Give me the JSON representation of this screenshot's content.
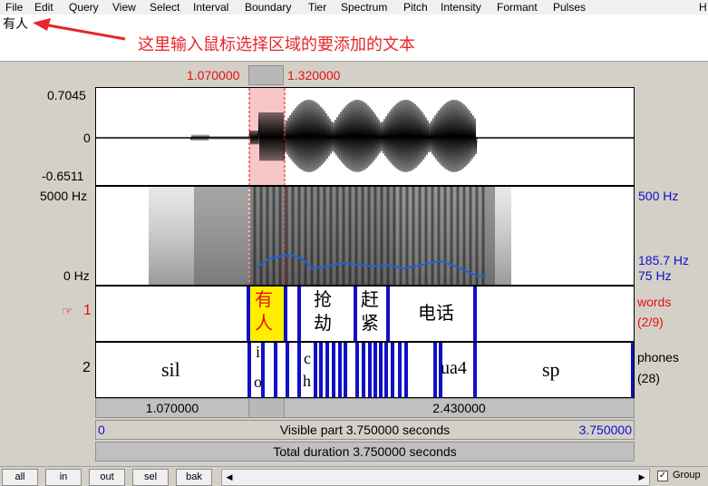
{
  "menu": [
    "File",
    "Edit",
    "Query",
    "View",
    "Select",
    "Interval",
    "Boundary",
    "Tier",
    "Spectrum",
    "Pitch",
    "Intensity",
    "Formant",
    "Pulses",
    "H"
  ],
  "text_entry": {
    "value": "有人"
  },
  "annotation": "这里输入鼠标选择区域的要添加的文本",
  "selection": {
    "start": "1.070000",
    "end": "1.320000"
  },
  "waveform": {
    "ymax": "0.7045",
    "zero": "0",
    "ymin": "-0.6511"
  },
  "spectrogram": {
    "top_left": "5000 Hz",
    "bottom_left": "0 Hz",
    "top_right": "500 Hz",
    "pitch_value": "185.7 Hz",
    "bottom_right": "75 Hz"
  },
  "tier1": {
    "marker": "☞",
    "number": "1",
    "name": "words",
    "count": "(2/9)",
    "selected_label": "有\n人",
    "labels": [
      {
        "id": "qiang",
        "text": "抢\n劫"
      },
      {
        "id": "gan",
        "text": "赶\n紧"
      },
      {
        "id": "dianhua",
        "text": "电话"
      }
    ]
  },
  "tier2": {
    "number": "2",
    "name": "phones",
    "count": "(28)",
    "labels": [
      {
        "id": "sil",
        "text": "sil"
      },
      {
        "id": "i",
        "text": "i"
      },
      {
        "id": "o",
        "text": "o"
      },
      {
        "id": "c",
        "text": "c"
      },
      {
        "id": "h",
        "text": "h"
      },
      {
        "id": "ua4",
        "text": "ua4"
      },
      {
        "id": "sp",
        "text": "sp"
      }
    ]
  },
  "strips": {
    "seg_left": "1.070000",
    "seg_right": "2.430000",
    "visible_start": "0",
    "visible_text": "Visible part 3.750000 seconds",
    "visible_end": "3.750000",
    "total_text": "Total duration 3.750000 seconds"
  },
  "toolbar": {
    "all": "all",
    "in": "in",
    "out": "out",
    "sel": "sel",
    "bak": "bak",
    "group_label": "Group",
    "group_checked": "✓"
  },
  "colors": {
    "selection_fill": "#f7c6c6",
    "selected_interval": "#ffee00",
    "boundary": "#1010c8",
    "pitch": "#2060e0",
    "red_text": "#e81010",
    "blue_text": "#1010c8"
  }
}
